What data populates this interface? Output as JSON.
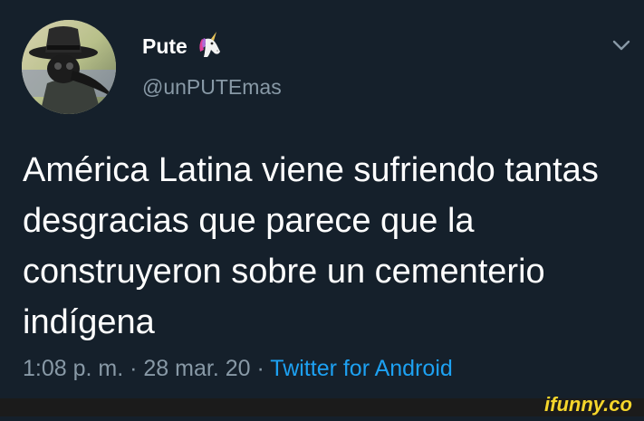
{
  "user": {
    "display_name": "Pute",
    "handle": "@unPUTEmas",
    "avatar_icon": "plague-doctor-avatar",
    "badge_icon": "unicorn-icon"
  },
  "tweet": {
    "text": "América Latina viene sufriendo tantas desgracias que parece que la construyeron sobre un cementerio indígena",
    "time": "1:08 p. m.",
    "separator": " · ",
    "date": "28 mar. 20",
    "source": "Twitter for Android"
  },
  "watermark": {
    "text": "ifunny.co"
  },
  "colors": {
    "background": "#15202b",
    "secondary_text": "#8899a6",
    "link": "#1da1f2",
    "watermark_yellow": "#f6d62b"
  }
}
